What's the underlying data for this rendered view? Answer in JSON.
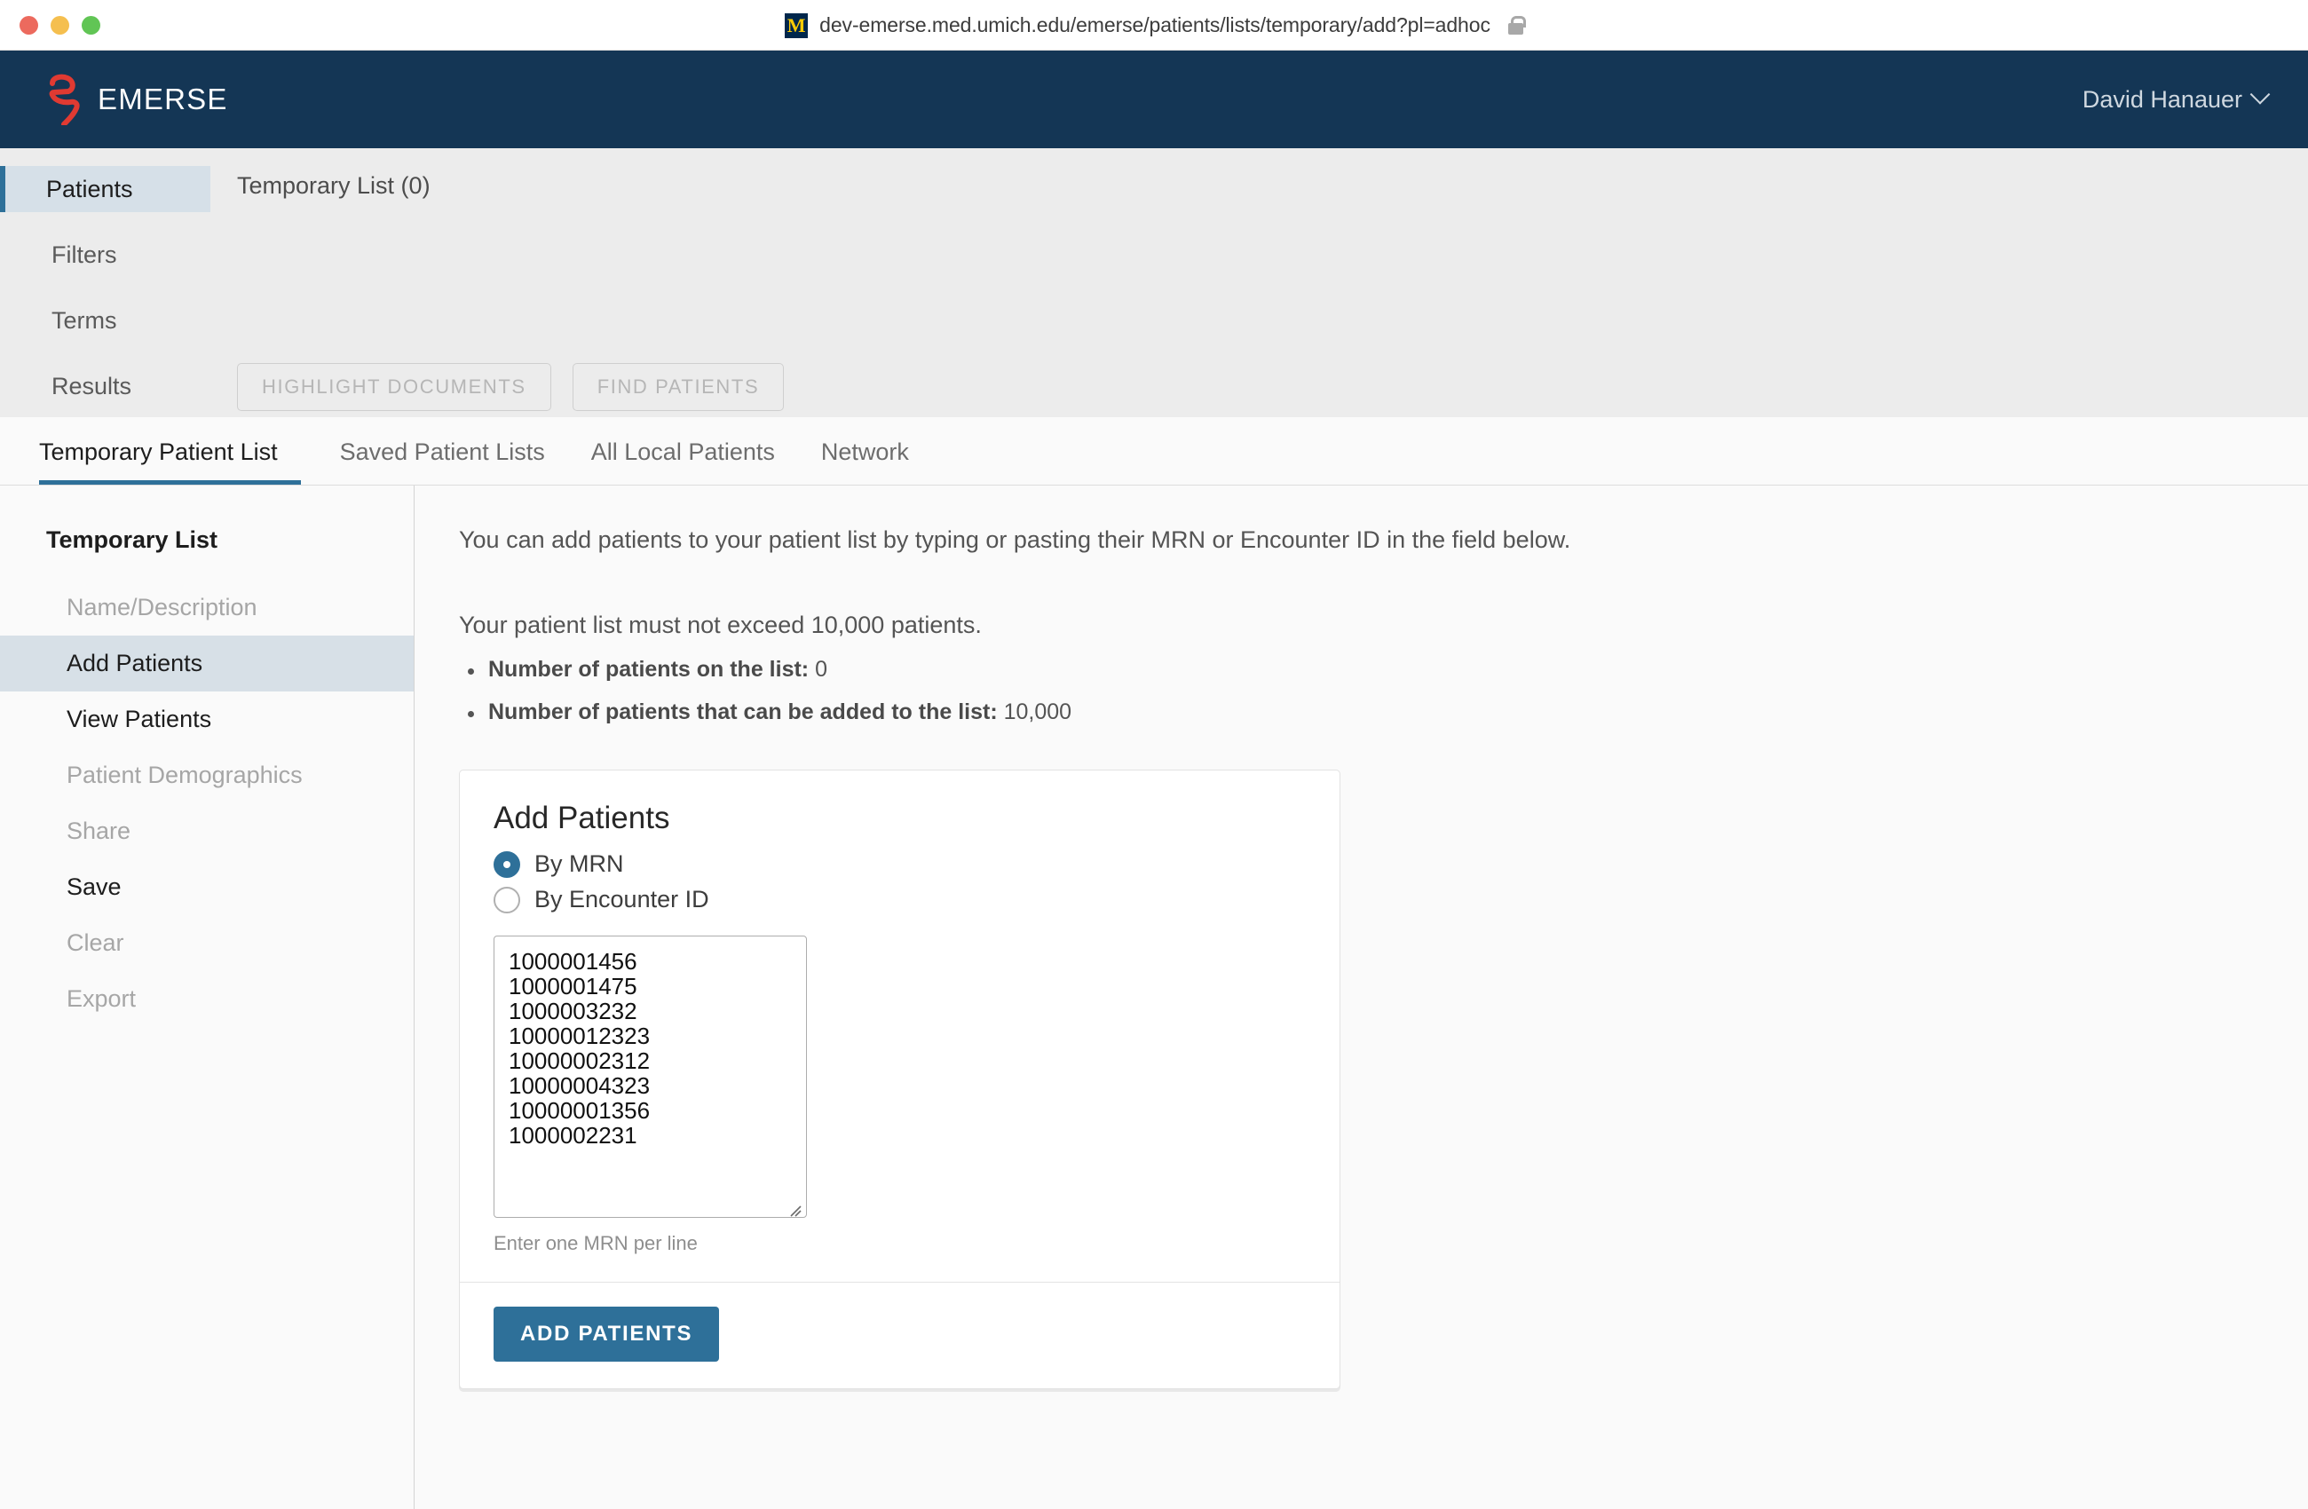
{
  "browser": {
    "url": "dev-emerse.med.umich.edu/emerse/patients/lists/temporary/add?pl=adhoc",
    "favicon_letter": "M",
    "lock_icon": "lock-icon",
    "traffic_lights": [
      "close",
      "minimize",
      "maximize"
    ]
  },
  "header": {
    "brand_name": "EMERSE",
    "logo_icon": "emerse-logo-icon",
    "user_name": "David Hanauer",
    "user_chevron_icon": "chevron-down-icon",
    "background_color": "#143655"
  },
  "workflow": {
    "steps": [
      {
        "label": "Patients",
        "active": true
      },
      {
        "label": "Filters",
        "active": false
      },
      {
        "label": "Terms",
        "active": false
      },
      {
        "label": "Results",
        "active": false
      }
    ],
    "context_label": "Temporary List (0)",
    "buttons": [
      {
        "label": "HIGHLIGHT DOCUMENTS",
        "disabled": true
      },
      {
        "label": "FIND PATIENTS",
        "disabled": true
      }
    ],
    "accent_color": "#2e7099"
  },
  "tabs": [
    {
      "label": "Temporary Patient List",
      "active": true
    },
    {
      "label": "Saved Patient Lists",
      "active": false
    },
    {
      "label": "All Local Patients",
      "active": false
    },
    {
      "label": "Network",
      "active": false
    }
  ],
  "sidebar": {
    "title": "Temporary List",
    "items": [
      {
        "label": "Name/Description",
        "state": "muted"
      },
      {
        "label": "Add Patients",
        "state": "selected"
      },
      {
        "label": "View Patients",
        "state": "normal"
      },
      {
        "label": "Patient Demographics",
        "state": "muted"
      },
      {
        "label": "Share",
        "state": "muted"
      },
      {
        "label": "Save",
        "state": "normal"
      },
      {
        "label": "Clear",
        "state": "muted"
      },
      {
        "label": "Export",
        "state": "muted"
      }
    ]
  },
  "main": {
    "intro": "You can add patients to your patient list by typing or pasting their MRN or Encounter ID in the field below.",
    "limit_text": "Your patient list must not exceed 10,000 patients.",
    "facts": [
      {
        "label": "Number of patients on the list:",
        "value": "0"
      },
      {
        "label": "Number of patients that can be added to the list:",
        "value": "10,000"
      }
    ]
  },
  "card": {
    "title": "Add Patients",
    "options": [
      {
        "label": "By MRN",
        "checked": true
      },
      {
        "label": "By Encounter ID",
        "checked": false
      }
    ],
    "textarea_value": "1000001456\n1000001475\n1000003232\n10000012323\n10000002312\n10000004323\n10000001356\n1000002231",
    "textarea_placeholder": "",
    "hint": "Enter one MRN per line",
    "submit_label": "ADD PATIENTS",
    "primary_color": "#2e7099"
  }
}
